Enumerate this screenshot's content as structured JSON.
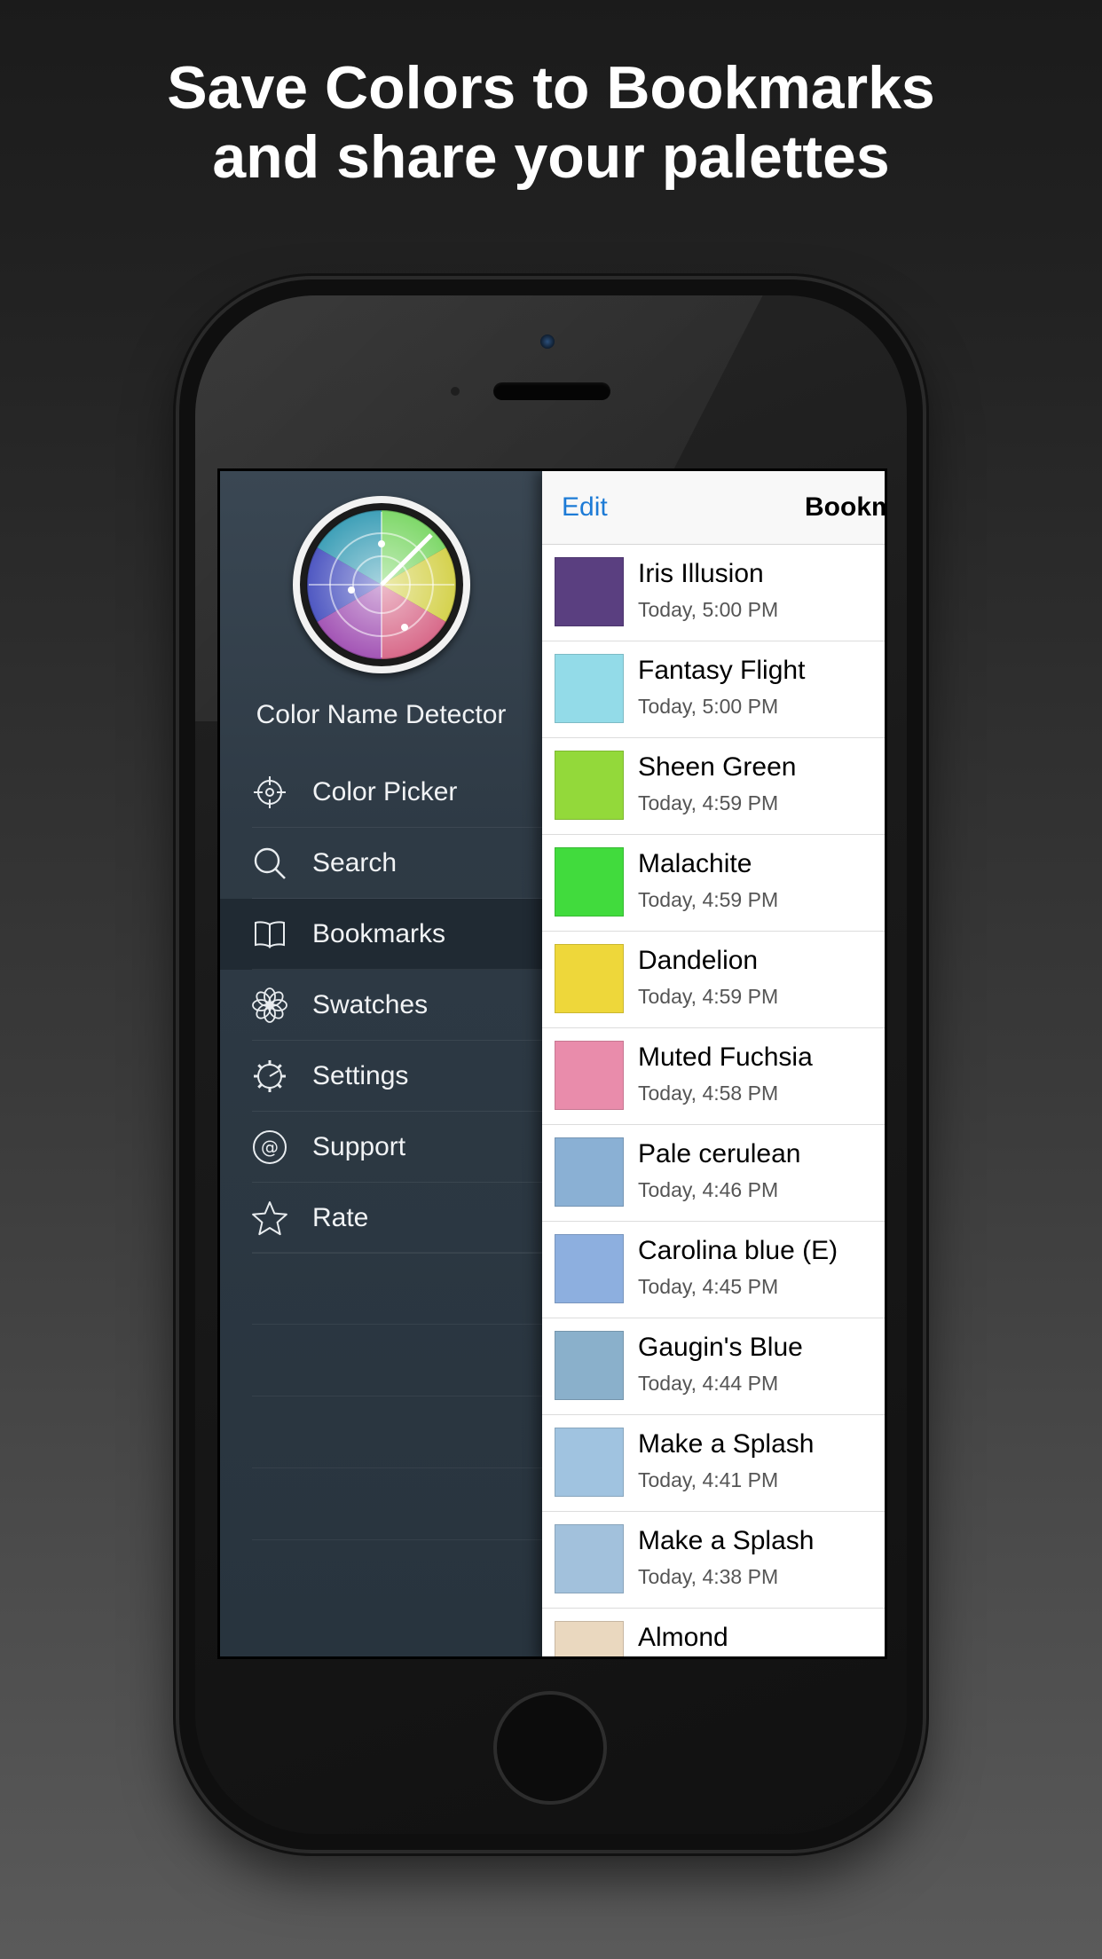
{
  "headline": {
    "line1": "Save Colors to Bookmarks",
    "line2": "and share your palettes"
  },
  "menu": {
    "app_name": "Color Name Detector",
    "items": [
      {
        "label": "Color Picker",
        "icon": "crosshair-icon"
      },
      {
        "label": "Search",
        "icon": "search-icon"
      },
      {
        "label": "Bookmarks",
        "icon": "book-icon",
        "active": true
      },
      {
        "label": "Swatches",
        "icon": "flower-icon"
      },
      {
        "label": "Settings",
        "icon": "gear-icon"
      },
      {
        "label": "Support",
        "icon": "at-icon"
      },
      {
        "label": "Rate",
        "icon": "star-icon"
      }
    ]
  },
  "panel": {
    "edit_label": "Edit",
    "title": "Bookmarks",
    "items": [
      {
        "name": "Iris Illusion",
        "time": "Today, 5:00 PM",
        "color": "#5a3f80"
      },
      {
        "name": "Fantasy Flight",
        "time": "Today, 5:00 PM",
        "color": "#93dbe8"
      },
      {
        "name": "Sheen Green",
        "time": "Today, 4:59 PM",
        "color": "#93d93a"
      },
      {
        "name": "Malachite",
        "time": "Today, 4:59 PM",
        "color": "#41db3d"
      },
      {
        "name": "Dandelion",
        "time": "Today, 4:59 PM",
        "color": "#eed73a"
      },
      {
        "name": "Muted Fuchsia",
        "time": "Today, 4:58 PM",
        "color": "#e98cab"
      },
      {
        "name": "Pale cerulean",
        "time": "Today, 4:46 PM",
        "color": "#8ab0d4"
      },
      {
        "name": "Carolina blue (E)",
        "time": "Today, 4:45 PM",
        "color": "#8dafdf"
      },
      {
        "name": "Gaugin's Blue",
        "time": "Today, 4:44 PM",
        "color": "#8ab0cb"
      },
      {
        "name": "Make a Splash",
        "time": "Today, 4:41 PM",
        "color": "#a0c3e0"
      },
      {
        "name": "Make a Splash",
        "time": "Today, 4:38 PM",
        "color": "#a2c1dc"
      },
      {
        "name": "Almond",
        "time": "",
        "color": "#ead8bf"
      }
    ]
  }
}
